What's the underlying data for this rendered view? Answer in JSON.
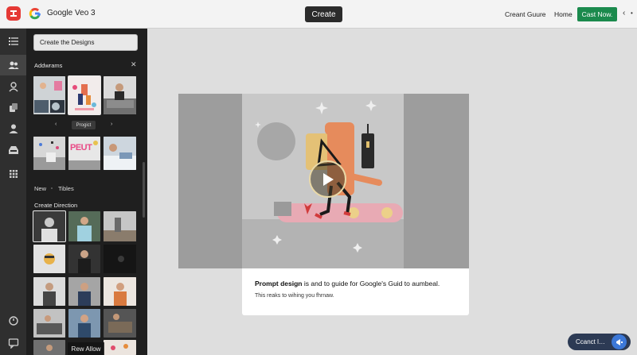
{
  "app": {
    "title": "Google Veo 3",
    "logo_icon": "hexagon-logo-icon",
    "brand_icon": "google-g-icon"
  },
  "topbar": {
    "create_label": "Create",
    "nav": [
      "Creant Guure",
      "Home"
    ],
    "cta_label": "Cast Now.",
    "back_icon": "chevron-left-icon",
    "more_icon": "chevron-right-icon"
  },
  "rail": {
    "icons": [
      "list-icon",
      "users-icon",
      "person-icon",
      "layers-icon",
      "profile-icon",
      "inbox-icon",
      "grid-icon",
      "power-icon",
      "chat-icon"
    ]
  },
  "panel": {
    "design_button": "Create the Designs",
    "section1_title": "Addwrams",
    "close_icon": "close-icon",
    "pager_label": "Progict",
    "pager_prev_icon": "chevron-left-icon",
    "pager_next_icon": "chevron-right-icon",
    "thumb_text": "PEUT",
    "tabs": [
      "New",
      "Tibles"
    ],
    "section2_title": "Create Direction",
    "overlay_label": "Rew Allow"
  },
  "preview": {
    "play_icon": "play-icon",
    "title_bold": "Prompt design",
    "title_rest": " is and to guide for Google's Guid to aumbeal.",
    "subtitle": "This reaks to wihing you fhrnaw."
  },
  "pill": {
    "label": "Ccanct l…",
    "icon": "megaphone-icon"
  },
  "colors": {
    "topbar_bg": "#f3f3f3",
    "rail_bg": "#2f2f2f",
    "panel_bg": "#1f1f1f",
    "cta_bg": "#1b8a4d",
    "canvas_bg": "#dedede",
    "pill_bg": "#2c3a54",
    "accent_blue": "#3c78d8"
  }
}
